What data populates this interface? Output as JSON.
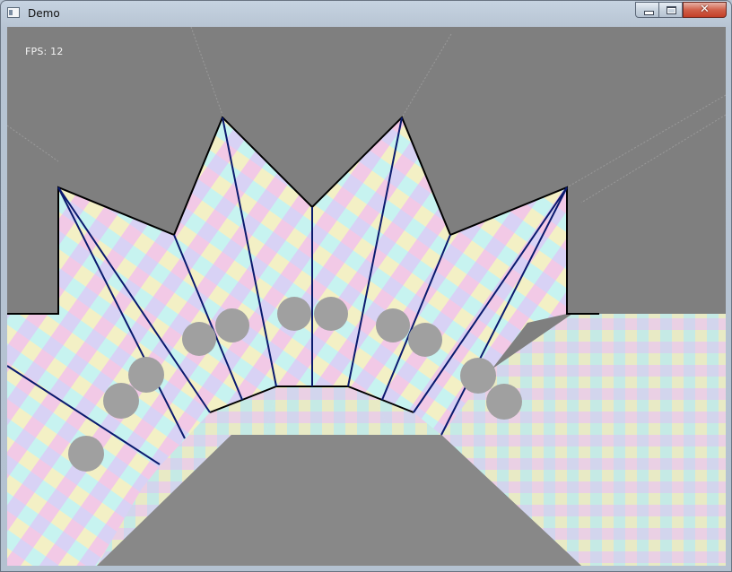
{
  "window": {
    "title": "Demo",
    "controls": {
      "minimize": "minimize",
      "maximize": "maximize",
      "close": "✕"
    }
  },
  "hud": {
    "fps_text": "FPS: 12"
  },
  "scene": {
    "background_color": "#7f7f7f",
    "ground_color": "#888888",
    "outline_color": "#000000",
    "crease_color": "#0a1a6e",
    "circle_color": "#a0a0a0"
  }
}
